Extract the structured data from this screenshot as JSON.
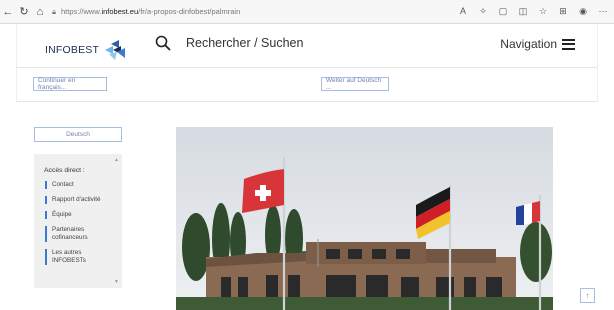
{
  "browser": {
    "url_prefix": "https://www.",
    "url_domain": "infobest.eu",
    "url_path": "/fr/a-propos-dinfobest/palmrain",
    "icons": [
      "back-icon",
      "refresh-icon",
      "home-icon",
      "lock-icon",
      "read-aloud-icon",
      "extensions-icon",
      "tab-icon",
      "sidebar-icon",
      "favorites-icon",
      "collections-icon",
      "profile-icon",
      "more-icon"
    ]
  },
  "header": {
    "logo_text": "INFOBEST",
    "search_label": "Rechercher / Suchen",
    "nav_label": "Navigation"
  },
  "language_bar": {
    "continue_fr": "Continuer en français...",
    "continue_de": "Weiter auf Deutsch ..."
  },
  "sidebar": {
    "language_button": "Deutsch",
    "access_title": "Accès direct :",
    "items": [
      {
        "label": "Contact"
      },
      {
        "label": "Rapport d'activité"
      },
      {
        "label": "Équipe"
      },
      {
        "label": "Partenaires cofinanceurs"
      },
      {
        "label": "Les autres INFOBESTs"
      }
    ]
  },
  "hero": {
    "subject": "INFOBEST Palmrain building with Swiss, German and French flags",
    "flags": [
      "switzerland",
      "germany",
      "france"
    ]
  },
  "back_to_top": "↑",
  "colors": {
    "accent_blue": "#3d7bd0",
    "link_blue": "#6d84b3",
    "border_blue": "#a7bde4",
    "navy": "#1d2d50"
  }
}
